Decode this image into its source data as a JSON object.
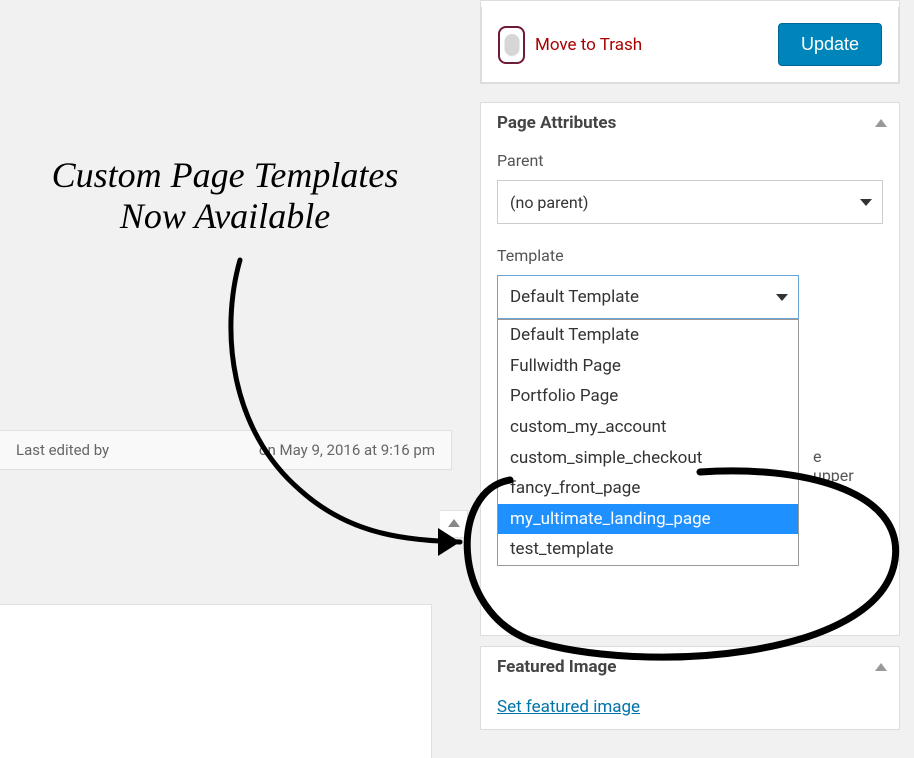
{
  "annotation": {
    "text": "Custom Page Templates\nNow Available"
  },
  "last_edited": {
    "prefix": "Last edited by",
    "timestamp": "on May 9, 2016 at 9:16 pm"
  },
  "publish_box": {
    "trash_label": "Move to Trash",
    "update_label": "Update"
  },
  "page_attributes": {
    "title": "Page Attributes",
    "parent_label": "Parent",
    "parent_value": "(no parent)",
    "template_label": "Template",
    "template_selected": "Default Template",
    "template_options": [
      "Default Template",
      "Fullwidth Page",
      "Portfolio Page",
      "custom_my_account",
      "custom_simple_checkout",
      "fancy_front_page",
      "my_ultimate_landing_page",
      "test_template"
    ],
    "template_highlight_index": 6,
    "peek_text": "e upper"
  },
  "featured_image": {
    "title": "Featured Image",
    "link_label": "Set featured image"
  }
}
